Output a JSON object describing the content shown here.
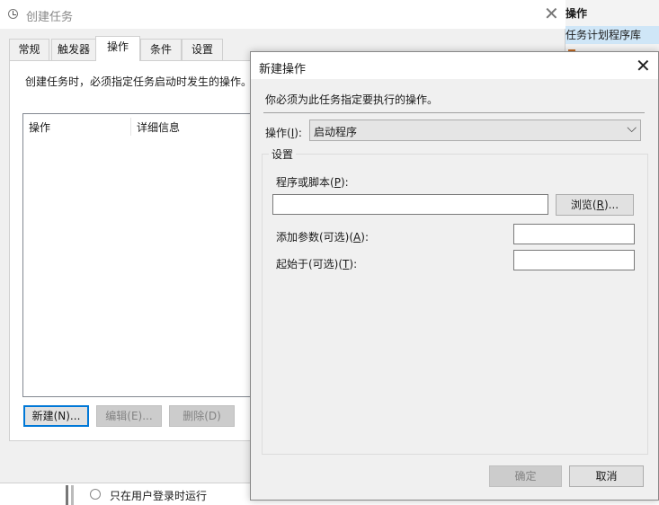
{
  "background": {
    "actions_panel_title": "操作",
    "library_item": "任务计划程序库",
    "radio_option": "只在用户登录时运行"
  },
  "create_task": {
    "title": "创建任务",
    "tabs": [
      {
        "label": "常规"
      },
      {
        "label": "触发器"
      },
      {
        "label": "操作",
        "active": true
      },
      {
        "label": "条件"
      },
      {
        "label": "设置"
      }
    ],
    "description": "创建任务时，必须指定任务启动时发生的操作。",
    "table_headers": [
      "操作",
      "详细信息"
    ],
    "buttons": {
      "new": "新建(N)...",
      "edit": "编辑(E)...",
      "delete": "删除(D)"
    }
  },
  "new_action": {
    "title": "新建操作",
    "description": "你必须为此任务指定要执行的操作。",
    "action_label_text": "操作(",
    "action_label_key": "I",
    "action_label_end": "):",
    "action_value": "启动程序",
    "settings_group": "设置",
    "program_label": {
      "pre": "程序或脚本(",
      "key": "P",
      "post": "):"
    },
    "program_value": "",
    "browse_button": {
      "pre": "浏览(",
      "key": "R",
      "post": ")..."
    },
    "args_label": {
      "pre": "添加参数(可选)(",
      "key": "A",
      "post": "):"
    },
    "args_value": "",
    "start_in_label": {
      "pre": "起始于(可选)(",
      "key": "T",
      "post": "):"
    },
    "start_in_value": "",
    "ok_button": "确定",
    "cancel_button": "取消"
  },
  "colors": {
    "accent": "#0078d7",
    "selected_item": "#cfe6f7",
    "dialog_bg": "#f0f0f0"
  }
}
